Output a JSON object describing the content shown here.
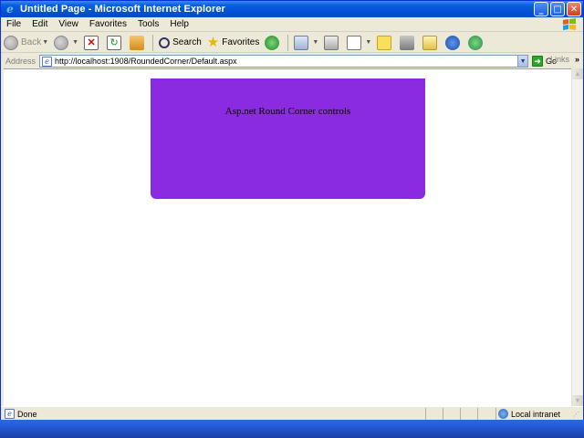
{
  "window": {
    "title": "Untitled Page - Microsoft Internet Explorer",
    "buttons": {
      "minimize": "_",
      "maximize": "□",
      "close": "✕"
    }
  },
  "menu": [
    "File",
    "Edit",
    "View",
    "Favorites",
    "Tools",
    "Help"
  ],
  "toolbar": {
    "back_label": "Back",
    "search_label": "Search",
    "favorites_label": "Favorites"
  },
  "address": {
    "label": "Address",
    "url": "http://localhost:1908/RoundedCorner/Default.aspx",
    "go_label": "Go",
    "links_label": "Links"
  },
  "content": {
    "panel_text": "Asp.net Round Corner controls",
    "panel_color": "#8a2be2"
  },
  "status": {
    "text": "Done",
    "zone": "Local intranet"
  },
  "icons": {
    "back": "back-arrow-icon",
    "forward": "forward-arrow-icon",
    "stop": "stop-icon",
    "refresh": "refresh-icon",
    "home": "home-icon",
    "search": "magnifier-icon",
    "favorites": "star-icon",
    "media": "media-icon",
    "mail": "mail-icon",
    "print": "printer-icon",
    "edit": "edit-icon",
    "discuss": "note-icon",
    "research": "research-icon",
    "messenger": "messenger-icon"
  }
}
